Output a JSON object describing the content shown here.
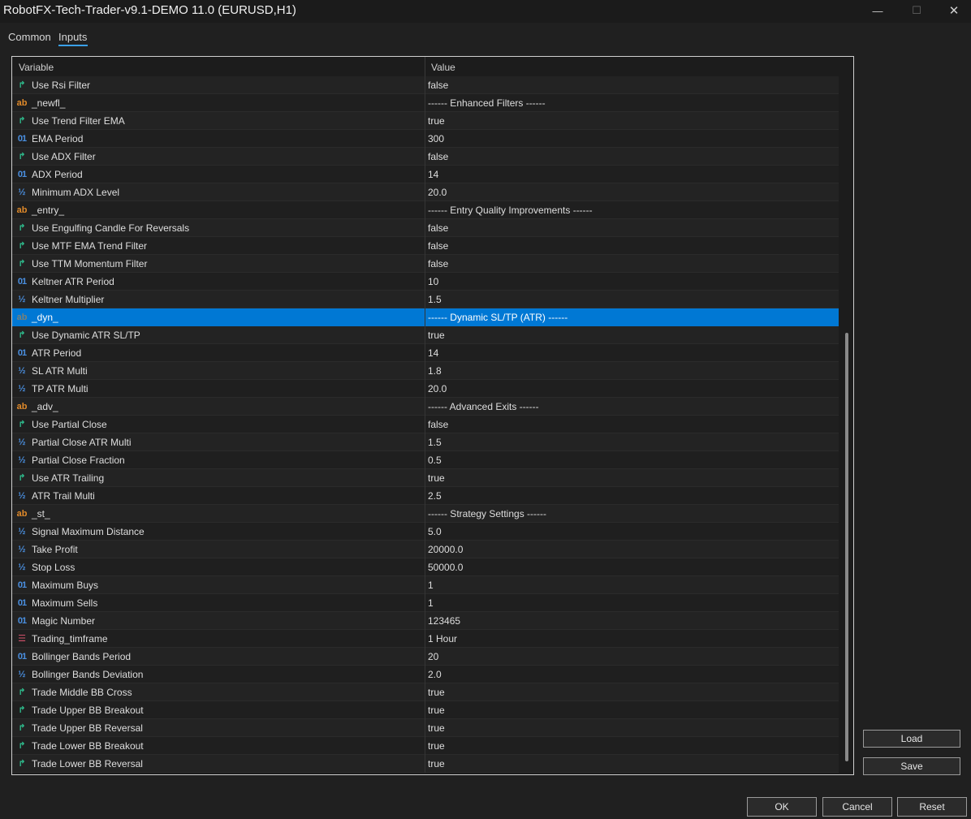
{
  "window": {
    "title": "RobotFX-Tech-Trader-v9.1-DEMO 11.0 (EURUSD,H1)",
    "minimize_glyph": "—",
    "maximize_glyph": "☐",
    "close_glyph": "✕"
  },
  "tabs": [
    {
      "label": "Common",
      "active": false
    },
    {
      "label": "Inputs",
      "active": true
    }
  ],
  "table": {
    "columns": {
      "variable": "Variable",
      "value": "Value"
    },
    "rows": [
      {
        "type": "bool",
        "icon": "bool-arrow-icon",
        "name": "Use Rsi Filter",
        "value": "false"
      },
      {
        "type": "string",
        "icon": "string-ab-icon",
        "name": "_newfl_",
        "value": "------ Enhanced Filters ------"
      },
      {
        "type": "bool",
        "icon": "bool-arrow-icon",
        "name": "Use Trend Filter EMA",
        "value": "true"
      },
      {
        "type": "int",
        "icon": "int-01-icon",
        "name": "EMA Period",
        "value": "300"
      },
      {
        "type": "bool",
        "icon": "bool-arrow-icon",
        "name": "Use ADX Filter",
        "value": "false"
      },
      {
        "type": "int",
        "icon": "int-01-icon",
        "name": "ADX Period",
        "value": "14"
      },
      {
        "type": "double",
        "icon": "double-half-icon",
        "name": "Minimum ADX Level",
        "value": "20.0"
      },
      {
        "type": "string",
        "icon": "string-ab-icon",
        "name": "_entry_",
        "value": "------ Entry Quality Improvements ------"
      },
      {
        "type": "bool",
        "icon": "bool-arrow-icon",
        "name": "Use Engulfing Candle For Reversals",
        "value": "false"
      },
      {
        "type": "bool",
        "icon": "bool-arrow-icon",
        "name": "Use MTF EMA Trend Filter",
        "value": "false"
      },
      {
        "type": "bool",
        "icon": "bool-arrow-icon",
        "name": "Use TTM Momentum Filter",
        "value": "false"
      },
      {
        "type": "int",
        "icon": "int-01-icon",
        "name": "Keltner ATR Period",
        "value": "10"
      },
      {
        "type": "double",
        "icon": "double-half-icon",
        "name": "Keltner Multiplier",
        "value": "1.5"
      },
      {
        "type": "string",
        "icon": "string-ab-icon",
        "name": "_dyn_",
        "value": "------ Dynamic SL/TP (ATR) ------",
        "selected": true
      },
      {
        "type": "bool",
        "icon": "bool-arrow-icon",
        "name": "Use Dynamic ATR SL/TP",
        "value": "true"
      },
      {
        "type": "int",
        "icon": "int-01-icon",
        "name": "ATR Period",
        "value": "14"
      },
      {
        "type": "double",
        "icon": "double-half-icon",
        "name": "SL ATR Multi",
        "value": "1.8"
      },
      {
        "type": "double",
        "icon": "double-half-icon",
        "name": "TP ATR Multi",
        "value": "20.0"
      },
      {
        "type": "string",
        "icon": "string-ab-icon",
        "name": "_adv_",
        "value": "------ Advanced Exits ------"
      },
      {
        "type": "bool",
        "icon": "bool-arrow-icon",
        "name": "Use Partial Close",
        "value": "false"
      },
      {
        "type": "double",
        "icon": "double-half-icon",
        "name": "Partial Close ATR Multi",
        "value": "1.5"
      },
      {
        "type": "double",
        "icon": "double-half-icon",
        "name": "Partial Close Fraction",
        "value": "0.5"
      },
      {
        "type": "bool",
        "icon": "bool-arrow-icon",
        "name": "Use ATR Trailing",
        "value": "true"
      },
      {
        "type": "double",
        "icon": "double-half-icon",
        "name": "ATR Trail Multi",
        "value": "2.5"
      },
      {
        "type": "string",
        "icon": "string-ab-icon",
        "name": "_st_",
        "value": "------ Strategy Settings ------"
      },
      {
        "type": "double",
        "icon": "double-half-icon",
        "name": "Signal Maximum Distance",
        "value": "5.0"
      },
      {
        "type": "double",
        "icon": "double-half-icon",
        "name": "Take Profit",
        "value": "20000.0"
      },
      {
        "type": "double",
        "icon": "double-half-icon",
        "name": "Stop Loss",
        "value": "50000.0"
      },
      {
        "type": "int",
        "icon": "int-01-icon",
        "name": "Maximum Buys",
        "value": "1"
      },
      {
        "type": "int",
        "icon": "int-01-icon",
        "name": "Maximum Sells",
        "value": "1"
      },
      {
        "type": "int",
        "icon": "int-01-icon",
        "name": "Magic Number",
        "value": "123465"
      },
      {
        "type": "enum",
        "icon": "enum-list-icon",
        "name": "Trading_timframe",
        "value": "1 Hour"
      },
      {
        "type": "int",
        "icon": "int-01-icon",
        "name": "Bollinger Bands Period",
        "value": "20"
      },
      {
        "type": "double",
        "icon": "double-half-icon",
        "name": "Bollinger Bands Deviation",
        "value": "2.0"
      },
      {
        "type": "bool",
        "icon": "bool-arrow-icon",
        "name": "Trade Middle BB Cross",
        "value": "true"
      },
      {
        "type": "bool",
        "icon": "bool-arrow-icon",
        "name": "Trade Upper BB Breakout",
        "value": "true"
      },
      {
        "type": "bool",
        "icon": "bool-arrow-icon",
        "name": "Trade Upper BB Reversal",
        "value": "true"
      },
      {
        "type": "bool",
        "icon": "bool-arrow-icon",
        "name": "Trade Lower BB Breakout",
        "value": "true"
      },
      {
        "type": "bool",
        "icon": "bool-arrow-icon",
        "name": "Trade Lower BB Reversal",
        "value": "true"
      }
    ]
  },
  "side_buttons": {
    "load": "Load",
    "save": "Save"
  },
  "footer_buttons": {
    "ok": "OK",
    "cancel": "Cancel",
    "reset": "Reset"
  },
  "colors": {
    "accent": "#0078d4",
    "selected_row": "#0078d4",
    "bool_icon": "#2fbf8f",
    "string_icon": "#e08a2a",
    "numeric_icon": "#4a8fe0",
    "enum_icon": "#d0506a"
  }
}
